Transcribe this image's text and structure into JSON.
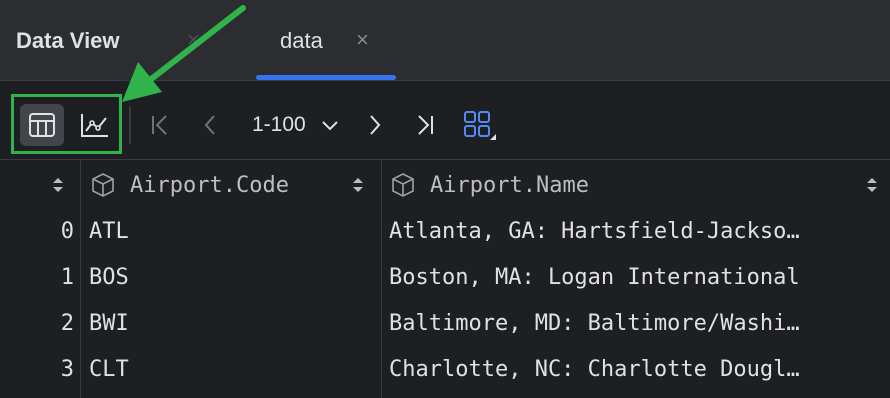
{
  "tabs": [
    {
      "label": "Data View",
      "active": false
    },
    {
      "label": "data",
      "active": true
    }
  ],
  "toolbar": {
    "table_view_icon": "table-icon",
    "chart_view_icon": "line-chart-icon",
    "pager_range": "1-100",
    "nav_icons": [
      "first-page-icon",
      "previous-page-icon",
      "next-page-icon",
      "last-page-icon",
      "layout-grid-icon"
    ]
  },
  "colors": {
    "accent": "#3574f0",
    "highlight_box": "#2fb34a",
    "background": "#1e1f22"
  },
  "table": {
    "columns": [
      "Airport.Code",
      "Airport.Name"
    ],
    "rows": [
      {
        "index": "0",
        "code": "ATL",
        "name": "Atlanta, GA: Hartsfield-Jackso…"
      },
      {
        "index": "1",
        "code": "BOS",
        "name": "Boston, MA: Logan International"
      },
      {
        "index": "2",
        "code": "BWI",
        "name": "Baltimore, MD: Baltimore/Washi…"
      },
      {
        "index": "3",
        "code": "CLT",
        "name": "Charlotte, NC: Charlotte Dougl…"
      }
    ]
  }
}
